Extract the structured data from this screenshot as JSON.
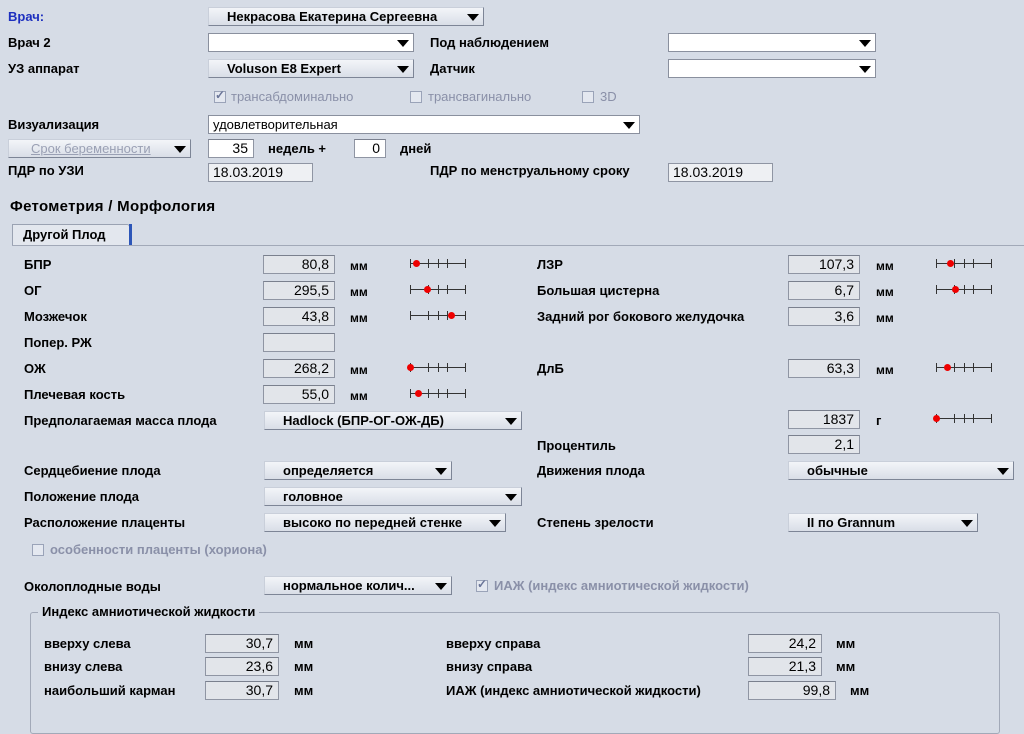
{
  "header": {
    "doctor_label": "Врач:",
    "doctor_value": "Некрасова Екатерина Сергеевна",
    "doctor2_label": "Врач 2",
    "doctor2_value": "",
    "observation_label": "Под наблюдением",
    "observation_value": "",
    "device_label": "УЗ аппарат",
    "device_value": "Voluson E8 Expert",
    "sensor_label": "Датчик",
    "sensor_value": "",
    "access_modes": [
      {
        "label": "трансабдоминально",
        "checked": true
      },
      {
        "label": "трансвагинально",
        "checked": false
      },
      {
        "label": "3D",
        "checked": false
      }
    ],
    "visualization_label": "Визуализация",
    "visualization_value": "удовлетворительная",
    "gestation_button": "Срок беременности",
    "weeks_value": "35",
    "weeks_label": "недель +",
    "days_value": "0",
    "days_label": "дней",
    "edd_us_label": "ПДР по УЗИ",
    "edd_us_value": "18.03.2019",
    "edd_lmp_label": "ПДР по менструальному сроку",
    "edd_lmp_value": "18.03.2019"
  },
  "section_title": "Фетометрия / Морфология",
  "tab_label": "Другой Плод",
  "left_measurements": [
    {
      "label": "БПР",
      "value": "80,8",
      "unit": "мм",
      "percentile_pos": 0.1
    },
    {
      "label": "ОГ",
      "value": "295,5",
      "unit": "мм",
      "percentile_pos": 0.3
    },
    {
      "label": "Мозжечок",
      "value": "43,8",
      "unit": "мм",
      "percentile_pos": 0.75
    },
    {
      "label": "Попер. РЖ",
      "value": "",
      "unit": "",
      "percentile_pos": null
    },
    {
      "label": "ОЖ",
      "value": "268,2",
      "unit": "мм",
      "percentile_pos": 0.0
    },
    {
      "label": "Плечевая кость",
      "value": "55,0",
      "unit": "мм",
      "percentile_pos": 0.15
    }
  ],
  "right_measurements": [
    {
      "label": "ЛЗР",
      "value": "107,3",
      "unit": "мм",
      "percentile_pos": 0.25
    },
    {
      "label": "Большая цистерна",
      "value": "6,7",
      "unit": "мм",
      "percentile_pos": 0.35
    },
    {
      "label": "Задний рог бокового желудочка",
      "value": "3,6",
      "unit": "мм",
      "percentile_pos": null
    },
    {
      "label": "ДлБ",
      "value": "63,3",
      "unit": "мм",
      "percentile_pos": 0.2
    }
  ],
  "weight": {
    "label": "Предполагаемая масса плода",
    "method": "Hadlock (БПР-ОГ-ОЖ-ДБ)",
    "value": "1837",
    "unit": "г",
    "percentile_pos": 0.0,
    "percentile_label": "Процентиль",
    "percentile_value": "2,1"
  },
  "findings": {
    "heartbeat_label": "Сердцебиение плода",
    "heartbeat_value": "определяется",
    "movement_label": "Движения плода",
    "movement_value": "обычные",
    "position_label": "Положение плода",
    "position_value": "головное",
    "placenta_label": "Расположение плаценты",
    "placenta_value": "высоко по передней стенке",
    "maturity_label": "Степень зрелости",
    "maturity_value": "II по Grannum",
    "placenta_features_label": "особенности плаценты (хориона)",
    "fluid_label": "Околоплодные воды",
    "fluid_value": "нормальное колич...",
    "afi_check_label": "ИАЖ (индекс амниотической жидкости)"
  },
  "afi": {
    "group_title": "Индекс амниотической жидкости",
    "upper_left_label": "вверху слева",
    "upper_left_value": "30,7",
    "lower_left_label": "внизу слева",
    "lower_left_value": "23,6",
    "max_pocket_label": "наибольший карман",
    "max_pocket_value": "30,7",
    "upper_right_label": "вверху справа",
    "upper_right_value": "24,2",
    "lower_right_label": "внизу справа",
    "lower_right_value": "21,3",
    "afi_label": "ИАЖ (индекс амниотической жидкости)",
    "afi_value": "99,8",
    "unit": "мм"
  },
  "colors": {
    "background": "#d6dce6",
    "marker": "#e00000",
    "accent": "#2d56b8"
  }
}
